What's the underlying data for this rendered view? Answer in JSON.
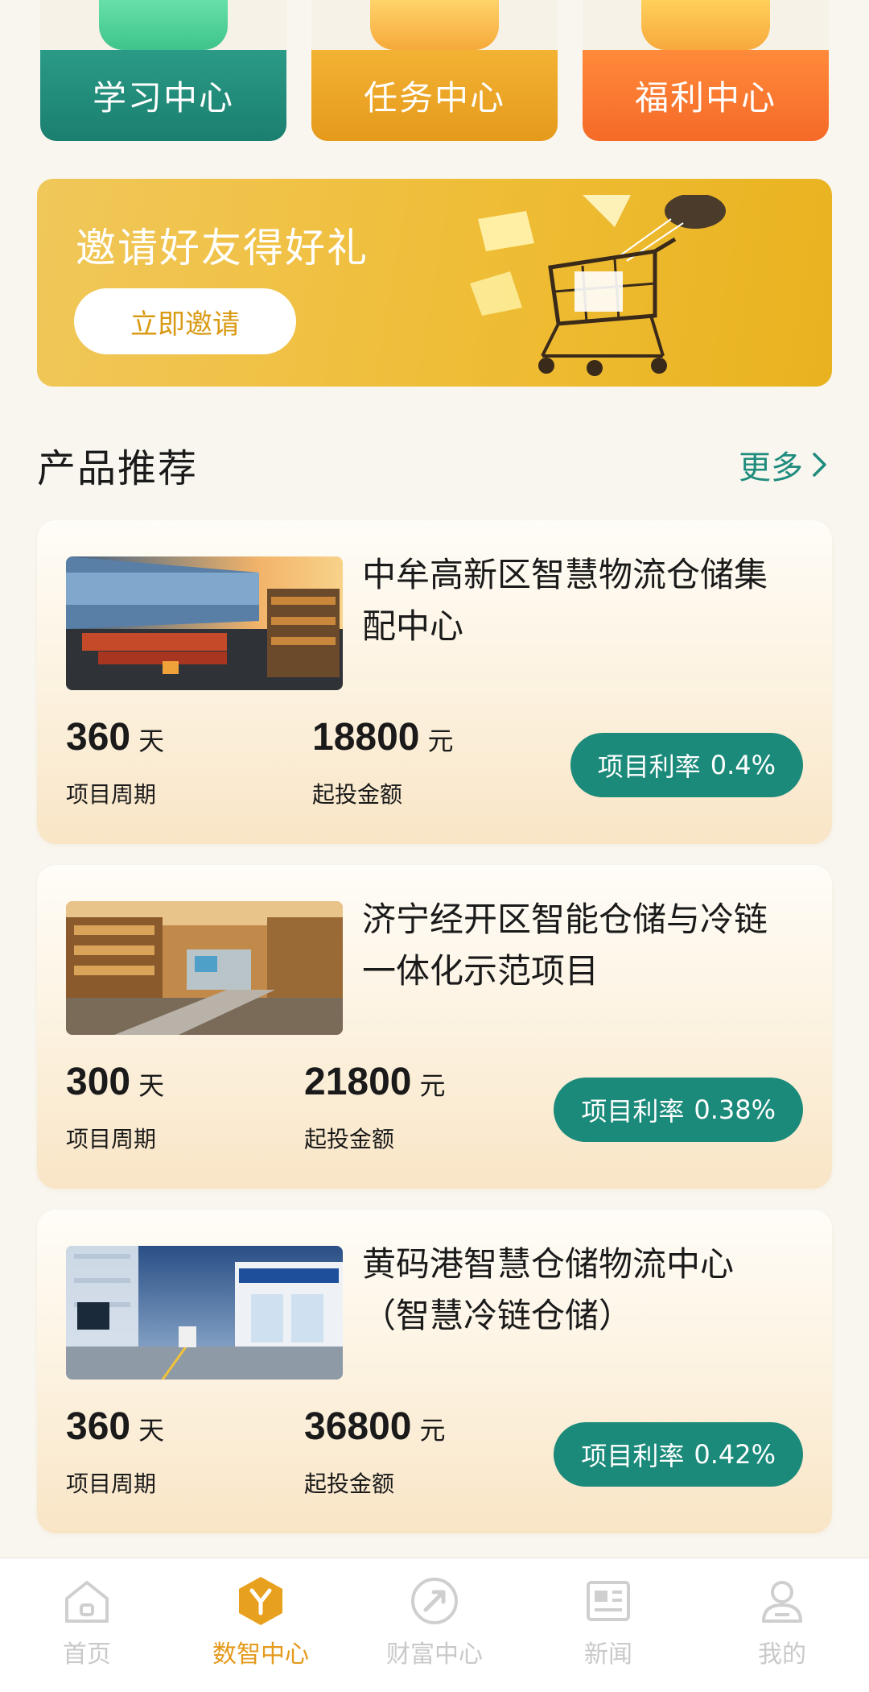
{
  "tiles": [
    {
      "label": "学习中心"
    },
    {
      "label": "任务中心"
    },
    {
      "label": "福利中心"
    }
  ],
  "banner": {
    "title": "邀请好友得好礼",
    "button_label": "立即邀请"
  },
  "section": {
    "title": "产品推荐",
    "more_label": "更多"
  },
  "products": [
    {
      "title": "中牟高新区智慧物流仓储集配中心",
      "period_value": "360",
      "period_unit": "天",
      "period_label": "项目周期",
      "amount_value": "18800",
      "amount_unit": "元",
      "amount_label": "起投金额",
      "rate_label": "项目利率",
      "rate_value": "0.4%"
    },
    {
      "title": "济宁经开区智能仓储与冷链一体化示范项目",
      "period_value": "300",
      "period_unit": "天",
      "period_label": "项目周期",
      "amount_value": "21800",
      "amount_unit": "元",
      "amount_label": "起投金额",
      "rate_label": "项目利率",
      "rate_value": "0.38%"
    },
    {
      "title": "黄码港智慧仓储物流中心（智慧冷链仓储）",
      "period_value": "360",
      "period_unit": "天",
      "period_label": "项目周期",
      "amount_value": "36800",
      "amount_unit": "元",
      "amount_label": "起投金额",
      "rate_label": "项目利率",
      "rate_value": "0.42%"
    }
  ],
  "nav": [
    {
      "label": "首页",
      "icon": "home-icon",
      "active": false
    },
    {
      "label": "数智中心",
      "icon": "hexagon-y-icon",
      "active": true
    },
    {
      "label": "财富中心",
      "icon": "compass-arrow-icon",
      "active": false
    },
    {
      "label": "新闻",
      "icon": "newspaper-icon",
      "active": false
    },
    {
      "label": "我的",
      "icon": "user-icon",
      "active": false
    }
  ],
  "colors": {
    "accent_teal": "#1b8a7a",
    "accent_orange": "#e49a1b",
    "nav_inactive": "#c9c9c9"
  }
}
